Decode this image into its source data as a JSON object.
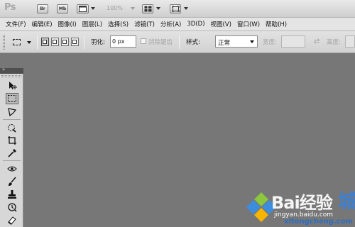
{
  "app": {
    "logo_text": "Ps",
    "title_buttons": [
      {
        "label": "Br",
        "icon": "bridge-icon"
      },
      {
        "label": "Mb",
        "icon": "mini-bridge-icon"
      },
      {
        "label": "",
        "icon": "view-extras-icon"
      },
      {
        "label": "",
        "icon": "arrange-documents-icon"
      },
      {
        "label": "",
        "icon": "screen-mode-icon"
      }
    ],
    "zoom_level": "100%"
  },
  "menu": {
    "items": [
      "文件(F)",
      "编辑(E)",
      "图像(I)",
      "图层(L)",
      "选择(S)",
      "滤镜(T)",
      "分析(A)",
      "3D(D)",
      "视图(V)",
      "窗口(W)",
      "帮助(H)"
    ]
  },
  "options": {
    "feather_label": "羽化:",
    "feather_value": "0 px",
    "antialias_label": "消除锯齿",
    "style_label": "样式:",
    "style_value": "正常",
    "width_label": "宽度:",
    "height_label": "高度:",
    "selection_modes": [
      "new-selection",
      "add-to-selection",
      "subtract-from-selection",
      "intersect-with-selection"
    ]
  },
  "tools_panel": {
    "collapse_glyph": "»",
    "tools": [
      "move-tool",
      "rectangular-marquee-tool",
      "lasso-tool",
      "quick-selection-tool",
      "crop-tool",
      "eyedropper-tool",
      "spot-healing-brush-tool",
      "brush-tool",
      "clone-stamp-tool",
      "history-brush-tool",
      "eraser-tool",
      "gradient-tool"
    ],
    "active_tool": "rectangular-marquee-tool"
  },
  "watermark": {
    "brand_text": "Bai",
    "brand_suffix": "经验",
    "cheng_char": "城",
    "sub_text": "jingyan.baidu.com",
    "site_text": "xitongcheng.com"
  },
  "colors": {
    "workspace": "#777777",
    "chrome": "#d7d7d7",
    "accent_blue": "#3d7fd0"
  }
}
